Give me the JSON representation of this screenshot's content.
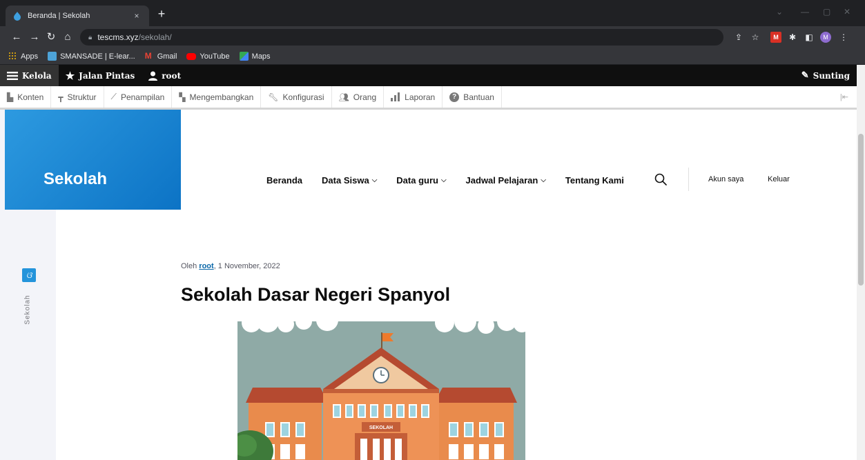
{
  "browser": {
    "tab_title": "Beranda | Sekolah",
    "tab_close": "×",
    "new_tab": "+",
    "url_host": "tescms.xyz",
    "url_path": "/sekolah/",
    "profile_initial": "M"
  },
  "bookmarks": [
    {
      "label": "Apps",
      "icon": "apps-grid-icon",
      "color": "#fbbc04"
    },
    {
      "label": "SMANSADE | E-lear...",
      "icon": "elearning-icon",
      "color": "#4da3d8"
    },
    {
      "label": "Gmail",
      "icon": "gmail-icon",
      "color": "#ea4335"
    },
    {
      "label": "YouTube",
      "icon": "youtube-icon",
      "color": "#ff0000"
    },
    {
      "label": "Maps",
      "icon": "maps-icon",
      "color": "#34a853"
    }
  ],
  "admin_toolbar": {
    "manage": "Kelola",
    "shortcuts": "Jalan Pintas",
    "user": "root",
    "edit": "Sunting"
  },
  "admin_tray": [
    {
      "label": "Konten",
      "icon": "file-icon"
    },
    {
      "label": "Struktur",
      "icon": "sitemap-icon"
    },
    {
      "label": "Penampilan",
      "icon": "paintbrush-icon"
    },
    {
      "label": "Mengembangkan",
      "icon": "puzzle-icon"
    },
    {
      "label": "Konfigurasi",
      "icon": "wrench-icon"
    },
    {
      "label": "Orang",
      "icon": "people-icon"
    },
    {
      "label": "Laporan",
      "icon": "bar-chart-icon"
    },
    {
      "label": "Bantuan",
      "icon": "help-icon"
    }
  ],
  "site": {
    "name": "Sekolah",
    "rail_label": "Sekolah",
    "nav": [
      {
        "label": "Beranda",
        "dropdown": false
      },
      {
        "label": "Data Siswa",
        "dropdown": true
      },
      {
        "label": "Data guru",
        "dropdown": true
      },
      {
        "label": "Jadwal Pelajaran",
        "dropdown": true
      },
      {
        "label": "Tentang Kami",
        "dropdown": false
      }
    ],
    "account": "Akun saya",
    "logout": "Keluar",
    "accent": "#1b84d2"
  },
  "article": {
    "by_prefix": "Oleh ",
    "author": "root",
    "date": ", 1 November, 2022",
    "title": "Sekolah Dasar Negeri Spanyol",
    "sign_text": "SEKOLAH"
  }
}
